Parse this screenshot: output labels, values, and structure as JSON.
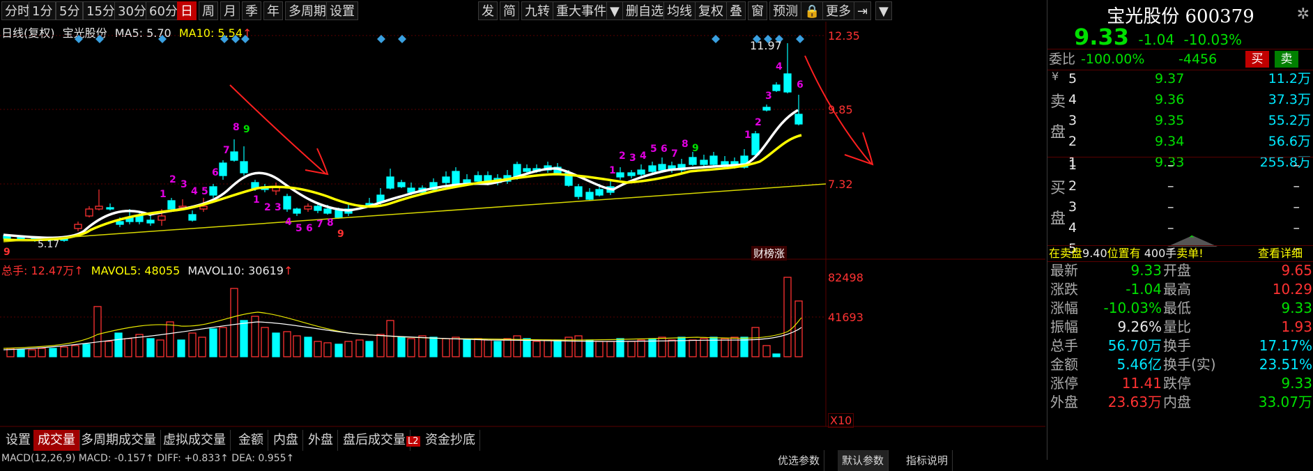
{
  "toolbar": {
    "left_items": [
      "分时",
      "1分",
      "5分",
      "15分",
      "30分",
      "60分",
      "日",
      "周",
      "月",
      "季",
      "年",
      "多周期",
      "设置"
    ],
    "active": "日",
    "right_items": [
      "发",
      "简",
      "九转",
      "重大事件",
      "▼",
      "删自选",
      "均线",
      "复权",
      "叠",
      "窗",
      "预测",
      "🔒",
      "更多",
      "⇥",
      "▼"
    ]
  },
  "kline_info": {
    "period": "日线(复权)",
    "name": "宝光股份",
    "ma5_label": "MA5: 5.70",
    "ma10_label": "MA10: 5.54",
    "up_arrow": "↑"
  },
  "price_axis": {
    "top": "12.35",
    "mid": "9.85",
    "low": "7.32"
  },
  "annotations": {
    "high": "11.97",
    "low": "5.17",
    "tag": "财榜涨",
    "nine_turn_labels": [
      "1",
      "2",
      "3",
      "4",
      "5",
      "6",
      "7",
      "8",
      "9"
    ]
  },
  "volume_info": {
    "total": "总手: 12.47万",
    "mavol5": "MAVOL5: 48055",
    "mavol10": "MAVOL10: 30619",
    "axis_top": "82498",
    "axis_mid": "41693",
    "axis_unit": "X10"
  },
  "bottom_tabs": [
    "设置",
    "成交量",
    "多周期成交量",
    "虚拟成交量",
    "金额",
    "内盘",
    "外盘",
    "盘后成交量",
    "资金抄底"
  ],
  "bottom_active": "成交量",
  "bottom_l2_badge": "L2",
  "macd_partial": "MACD(12,26,9) MACD: -0.157↑ DIFF: +0.833↑ DEA: 0.955↑",
  "bottom_right_tabs": [
    "优选参数",
    "默认参数",
    "指标说明"
  ],
  "quote": {
    "name": "宝光股份",
    "code": "600379",
    "price": "9.33",
    "change": "-1.04",
    "change_pct": "-10.03%",
    "weibi_label": "委比",
    "weibi": "-100.00%",
    "weicha": "-4456",
    "buy_btn": "买",
    "sell_btn": "卖",
    "sell_side_label": [
      "卖",
      "盘"
    ],
    "buy_side_label": [
      "买",
      "盘"
    ],
    "yen": "¥",
    "asks": [
      {
        "level": "5",
        "price": "9.37",
        "vol": "11.2万"
      },
      {
        "level": "4",
        "price": "9.36",
        "vol": "37.3万"
      },
      {
        "level": "3",
        "price": "9.35",
        "vol": "55.2万"
      },
      {
        "level": "2",
        "price": "9.34",
        "vol": "56.6万"
      },
      {
        "level": "1",
        "price": "9.33",
        "vol": "255.8万"
      }
    ],
    "bids": [
      {
        "level": "1",
        "price": "–",
        "vol": "–"
      },
      {
        "level": "2",
        "price": "–",
        "vol": "–"
      },
      {
        "level": "3",
        "price": "–",
        "vol": "–"
      },
      {
        "level": "4",
        "price": "–",
        "vol": "–"
      },
      {
        "level": "5",
        "price": "–",
        "vol": "–"
      }
    ],
    "notice_prefix": "在卖盘",
    "notice_price": "9.40",
    "notice_mid": "位置有",
    "notice_qty": "400手",
    "notice_suffix": "卖单!",
    "notice_link": "查看详细",
    "stats": [
      {
        "l": "最新",
        "lv": "9.33",
        "r": "开盘",
        "rv": "9.65",
        "lc": "green",
        "rc": "red"
      },
      {
        "l": "涨跌",
        "lv": "-1.04",
        "r": "最高",
        "rv": "10.29",
        "lc": "green",
        "rc": "red"
      },
      {
        "l": "涨幅",
        "lv": "-10.03%",
        "r": "最低",
        "rv": "9.33",
        "lc": "green",
        "rc": "green"
      },
      {
        "l": "振幅",
        "lv": "9.26%",
        "r": "量比",
        "rv": "1.93",
        "lc": "white",
        "rc": "red"
      },
      {
        "l": "总手",
        "lv": "56.70万",
        "r": "换手",
        "rv": "17.17%",
        "lc": "cyan",
        "rc": "cyan"
      },
      {
        "l": "金额",
        "lv": "5.46亿",
        "r": "换手(实)",
        "rv": "23.51%",
        "lc": "cyan",
        "rc": "cyan"
      },
      {
        "l": "涨停",
        "lv": "11.41",
        "r": "跌停",
        "rv": "9.33",
        "lc": "red",
        "rc": "green"
      },
      {
        "l": "外盘",
        "lv": "23.63万",
        "r": "内盘",
        "rv": "33.07万",
        "lc": "red",
        "rc": "green"
      }
    ]
  },
  "colors": {
    "up": "#ff3232",
    "down": "#00ffff",
    "ma5": "#ffffff",
    "ma10": "#ffff00",
    "accent": "#c00000"
  }
}
